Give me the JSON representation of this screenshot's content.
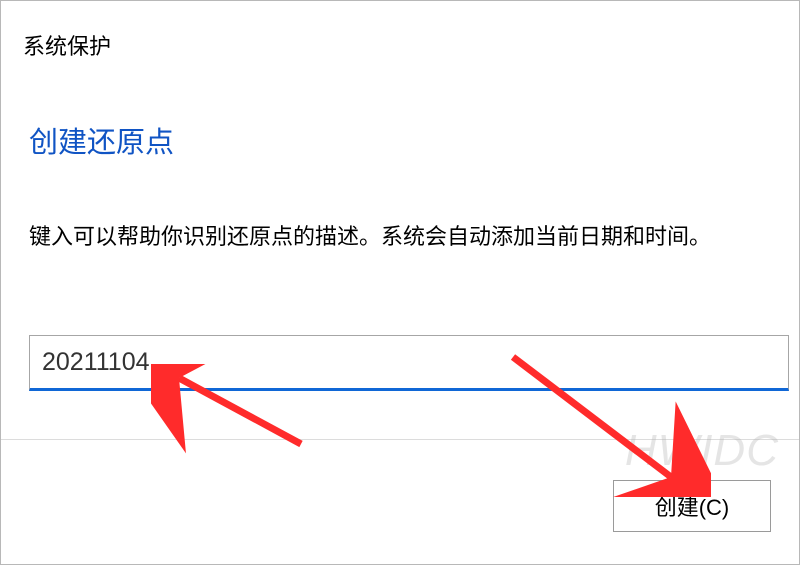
{
  "window": {
    "title": "系统保护"
  },
  "dialog": {
    "heading": "创建还原点",
    "description": "键入可以帮助你识别还原点的描述。系统会自动添加当前日期和时间。",
    "input_value": "20211104",
    "create_button": "创建(C)"
  },
  "watermark": "HWIDC"
}
